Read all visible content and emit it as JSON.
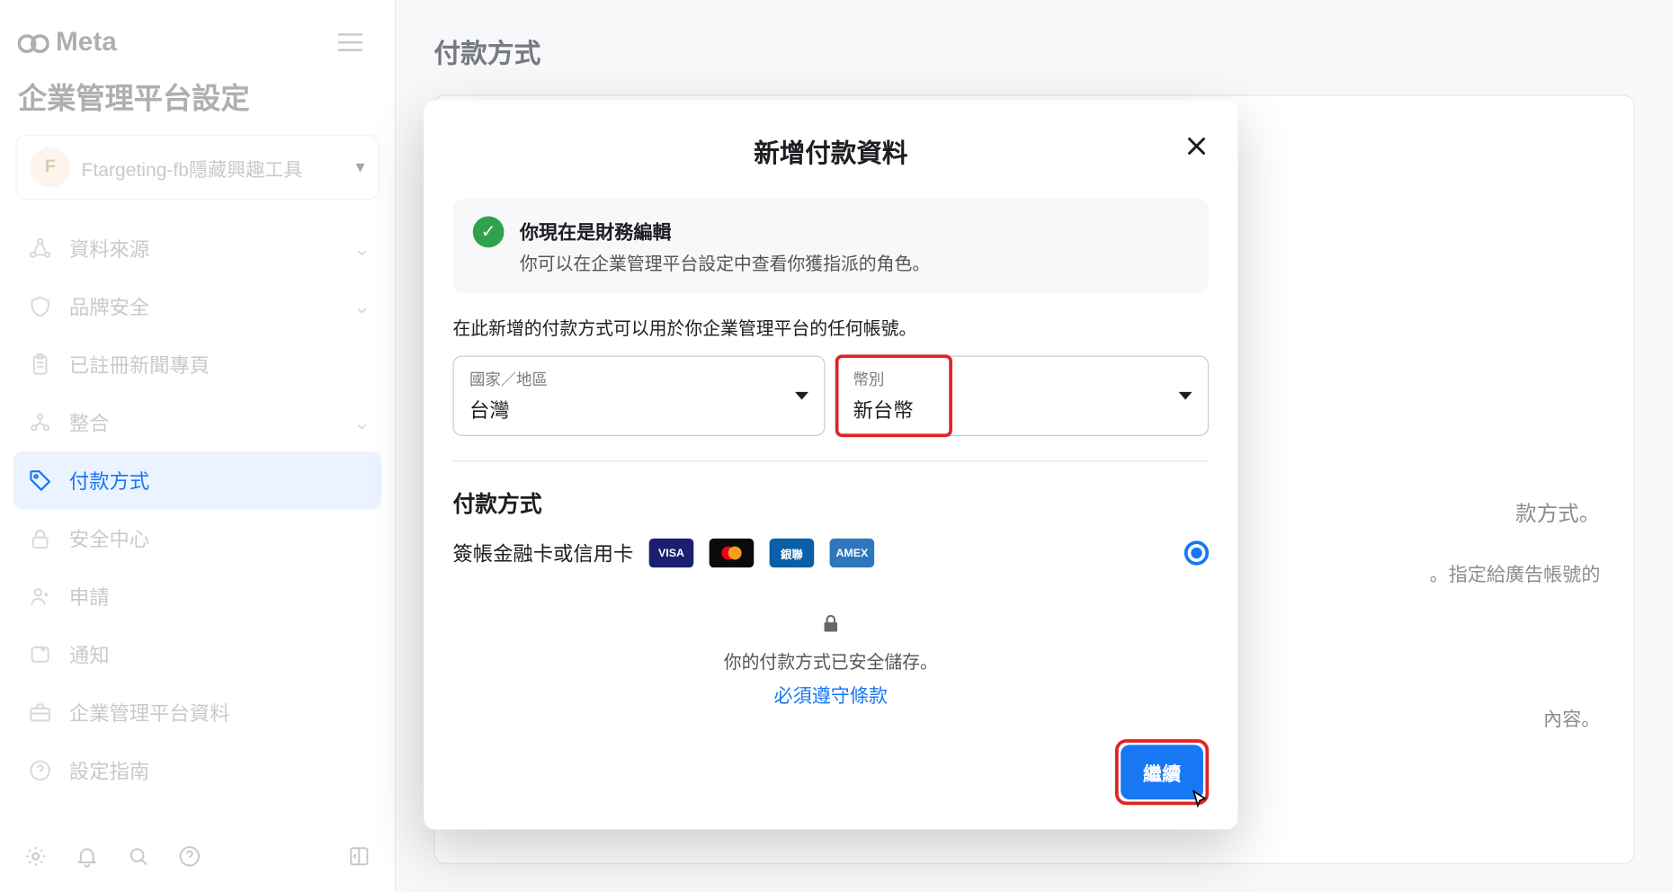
{
  "sidebar": {
    "brand": "Meta",
    "title": "企業管理平台設定",
    "account": {
      "avatar_letter": "F",
      "name": "Ftargeting-fb隱藏興趣工具"
    },
    "items": [
      {
        "label": "資料來源"
      },
      {
        "label": "品牌安全"
      },
      {
        "label": "已註冊新聞專頁"
      },
      {
        "label": "整合"
      },
      {
        "label": "付款方式"
      },
      {
        "label": "安全中心"
      },
      {
        "label": "申請"
      },
      {
        "label": "通知"
      },
      {
        "label": "企業管理平台資料"
      },
      {
        "label": "設定指南"
      }
    ]
  },
  "main": {
    "header": "付款方式",
    "bg_hint_right_1": "款方式。",
    "bg_hint_right_2": "。指定給廣告帳號的",
    "bg_hint_right_3": "內容。"
  },
  "modal": {
    "title": "新增付款資料",
    "info_title": "你現在是財務編輯",
    "info_sub": "你可以在企業管理平台設定中查看你獲指派的角色。",
    "form_note": "在此新增的付款方式可以用於你企業管理平台的任何帳號。",
    "country": {
      "label": "國家／地區",
      "value": "台灣"
    },
    "currency": {
      "label": "幣別",
      "value": "新台幣"
    },
    "section_title": "付款方式",
    "pay_option_label": "簽帳金融卡或信用卡",
    "card_brands": {
      "visa": "VISA",
      "mc": "●●",
      "cup": "銀聯",
      "amex": "AMEX"
    },
    "secure_text": "你的付款方式已安全儲存。",
    "terms_link": "必須遵守條款",
    "continue": "繼續"
  }
}
